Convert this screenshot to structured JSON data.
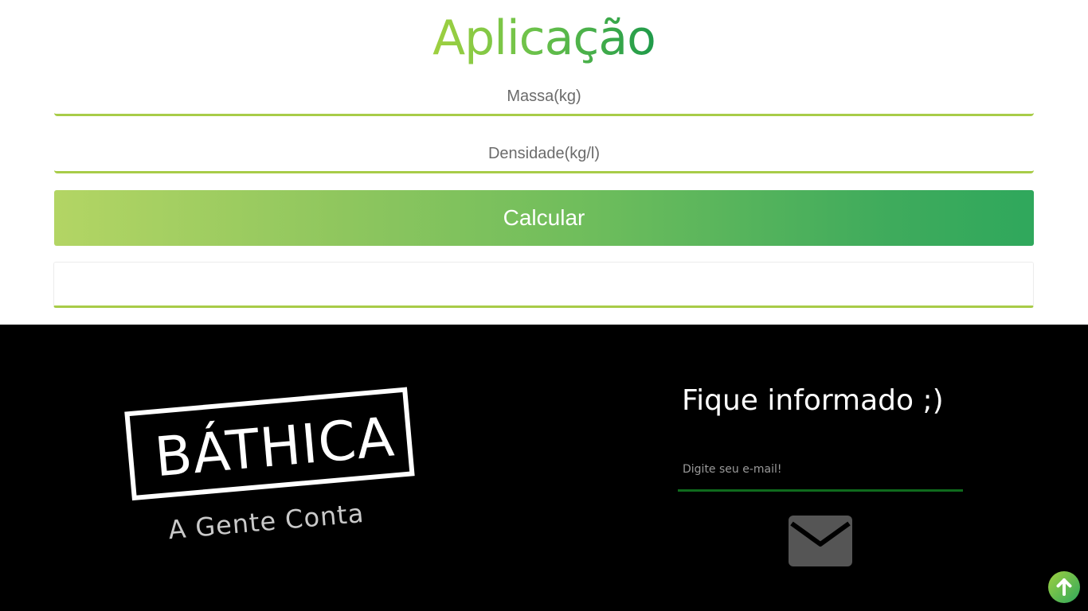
{
  "app": {
    "title": "Aplicação",
    "massa_placeholder": "Massa(kg)",
    "densidade_placeholder": "Densidade(kg/l)",
    "calculate_label": "Calcular",
    "result_value": ""
  },
  "footer": {
    "logo_text": "BÁTHICA",
    "logo_tagline": "A Gente Conta",
    "newsletter_title": "Fique informado ;)",
    "email_placeholder": "Digite seu e-mail!",
    "send_icon": "envelope-icon"
  },
  "scroll_top_icon": "arrow-up-icon",
  "colors": {
    "accent_green_light": "#a8cc48",
    "accent_green_dark": "#2fa85c",
    "footer_bg": "#000000",
    "email_underline": "#0f6b1d"
  }
}
